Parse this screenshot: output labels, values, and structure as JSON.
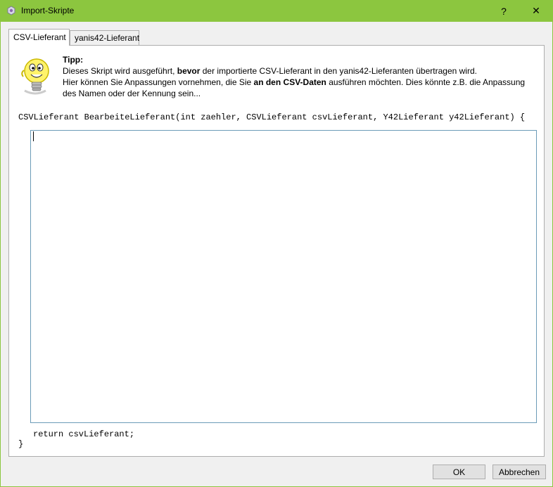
{
  "window": {
    "title": "Import-Skripte",
    "help_glyph": "?",
    "close_glyph": "✕",
    "frame_color": "#8cc63f"
  },
  "tabs": [
    {
      "label": "CSV-Lieferant",
      "active": true
    },
    {
      "label": "yanis42-Lieferant",
      "active": false
    }
  ],
  "tip": {
    "icon": "lightbulb-icon",
    "title": "Tipp:",
    "line1_a": "Dieses Skript wird ausgeführt, ",
    "line1_bold": "bevor",
    "line1_b": " der importierte CSV-Lieferant in den yanis42-Lieferanten übertragen wird.",
    "line2_a": "Hier können Sie Anpassungen vornehmen, die Sie ",
    "line2_bold": "an den CSV-Daten",
    "line2_b": " ausführen möchten. Dies könnte z.B. die Anpassung",
    "line3": "des Namen oder der Kennung sein..."
  },
  "code": {
    "signature": "CSVLieferant BearbeiteLieferant(int zaehler, CSVLieferant csvLieferant, Y42Lieferant y42Lieferant) {",
    "editor_value": "",
    "return_line": "return csvLieferant;",
    "closing_brace": "}"
  },
  "buttons": {
    "ok": "OK",
    "cancel": "Abbrechen"
  }
}
